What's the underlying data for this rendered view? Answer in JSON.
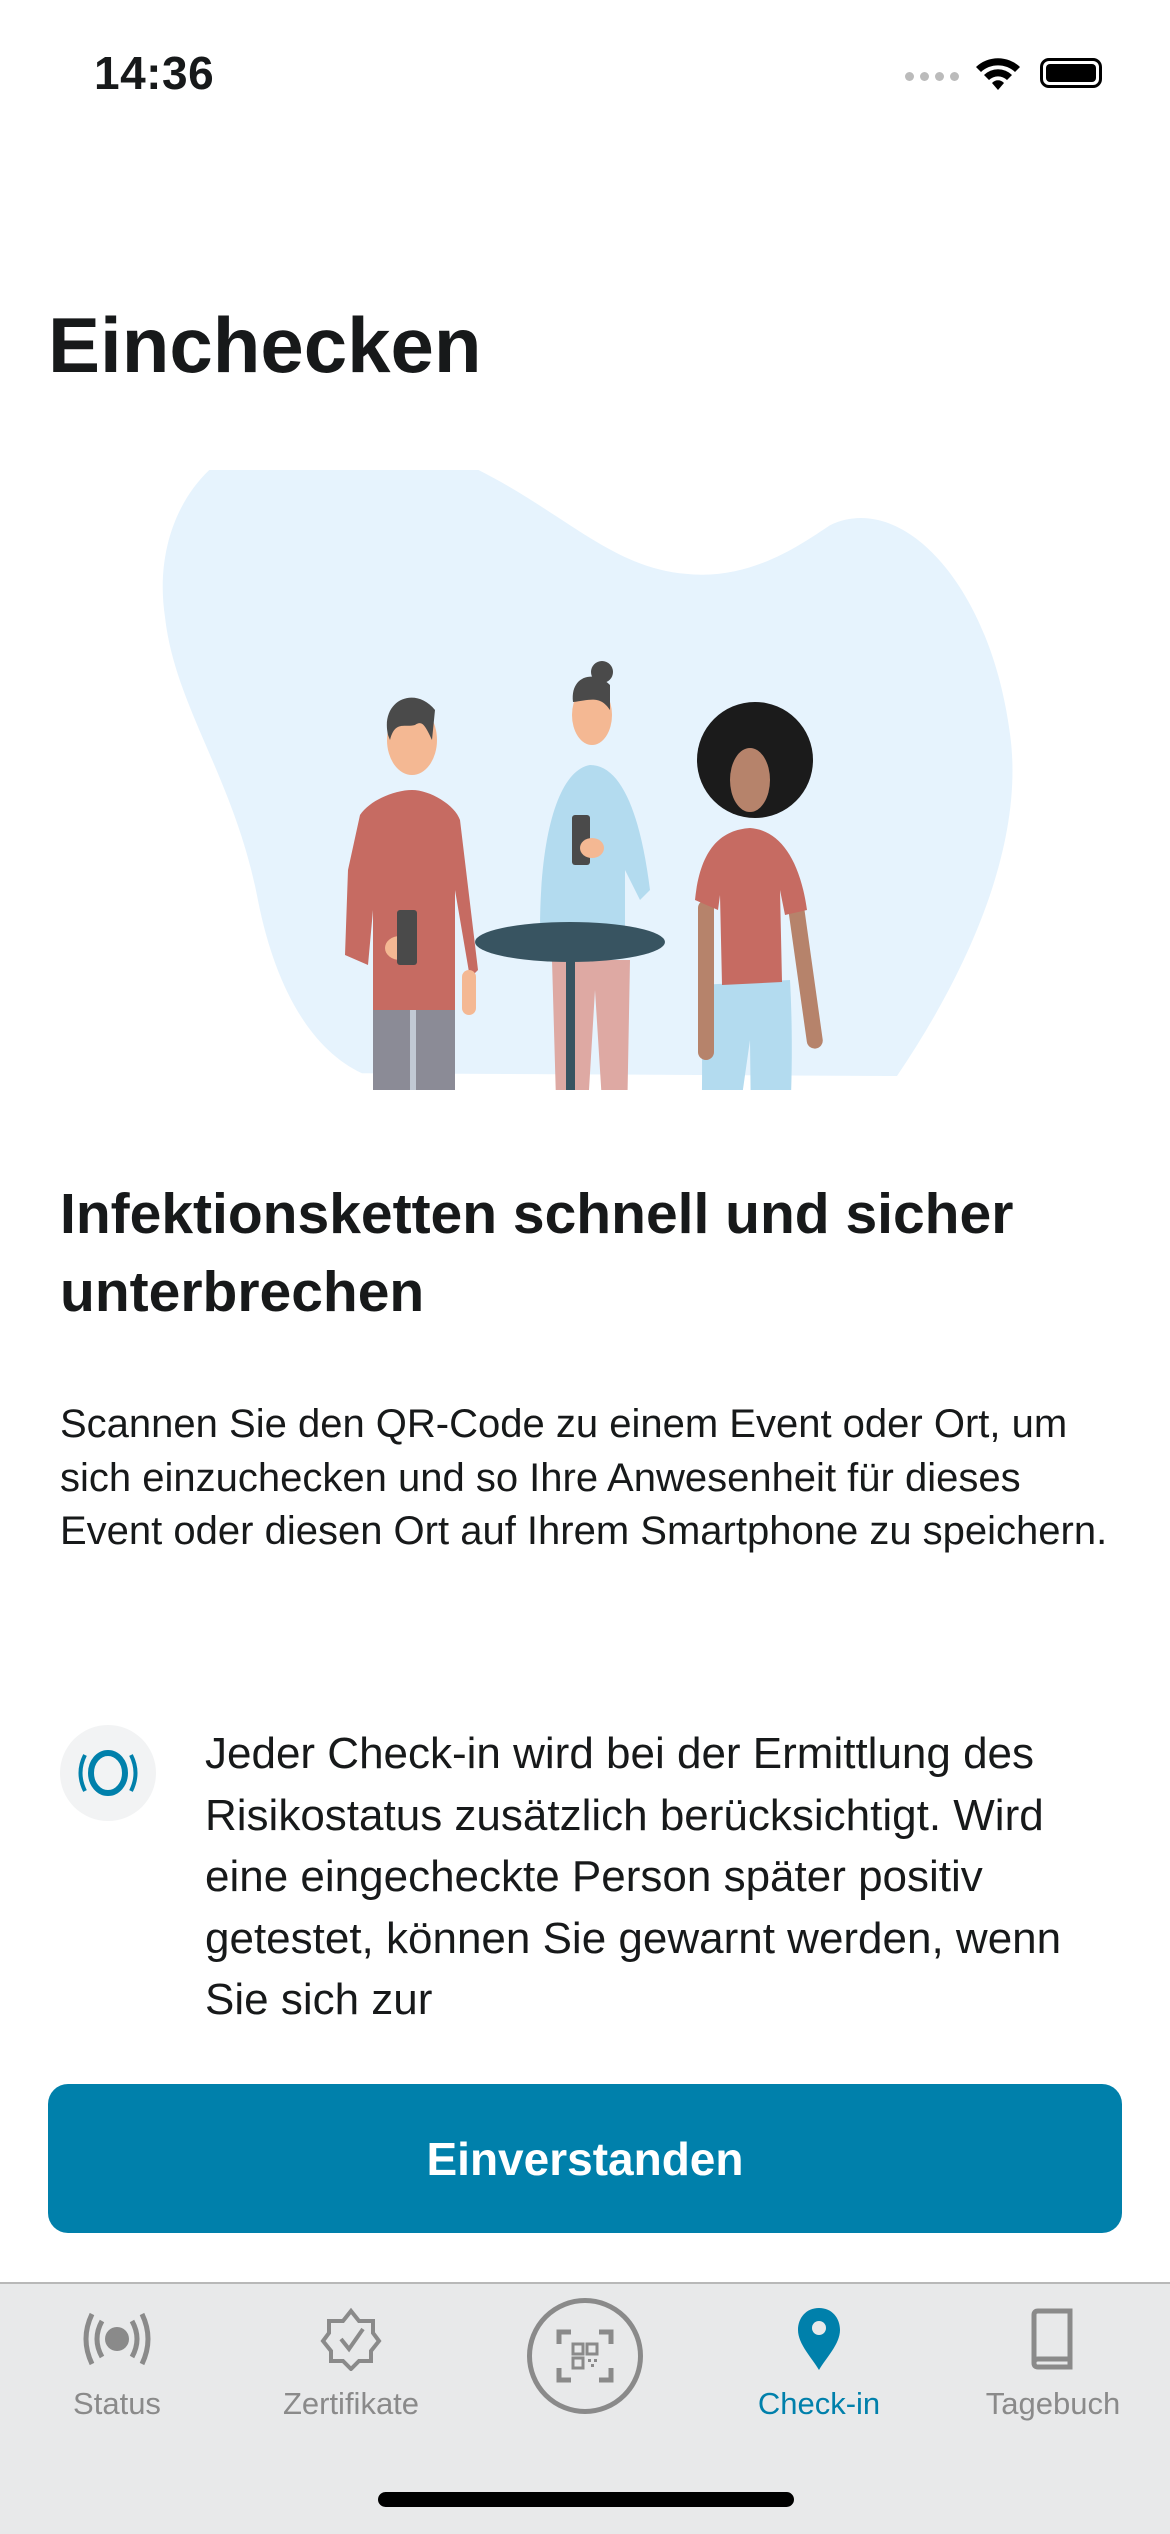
{
  "status_bar": {
    "time": "14:36",
    "signal_icon": "signal-dots-icon",
    "wifi_icon": "wifi-icon",
    "battery_icon": "battery-icon"
  },
  "page": {
    "title": "Einchecken",
    "headline": "Infektionsketten schnell und sicher unterbrechen",
    "body": "Scannen Sie den QR-Code zu einem Event oder Ort, um sich einzuchecken und so Ihre Anwesenheit für dieses Event oder diesen Ort auf Ihrem Smartphone zu speichern.",
    "feature": {
      "icon": "risk-status-icon",
      "text": "Jeder Check-in wird bei der Ermittlung des Risikostatus zusätzlich berücksichtigt. Wird eine eingecheckte Person später positiv getestet, können Sie gewarnt werden, wenn Sie sich zur"
    },
    "button_label": "Einverstanden"
  },
  "tabs": [
    {
      "label": "Status",
      "icon": "status-broadcast-icon",
      "active": false
    },
    {
      "label": "Zertifikate",
      "icon": "certificate-badge-icon",
      "active": false
    },
    {
      "label": "",
      "icon": "qr-scan-icon",
      "active": false
    },
    {
      "label": "Check-in",
      "icon": "location-pin-icon",
      "active": true
    },
    {
      "label": "Tagebuch",
      "icon": "diary-book-icon",
      "active": false
    }
  ],
  "colors": {
    "accent": "#0080ab",
    "text": "#17191a",
    "tab_inactive": "#8a8a8a"
  }
}
